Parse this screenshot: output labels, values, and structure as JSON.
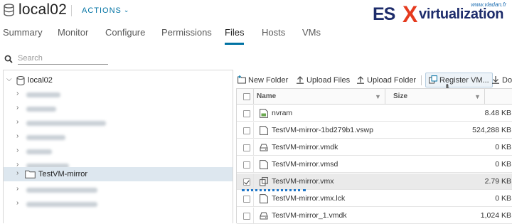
{
  "header": {
    "title": "local02",
    "actions_label": "ACTIONS",
    "actions_caret": "⌄"
  },
  "logo": {
    "url": "www.vladan.fr",
    "es": "ES",
    "x": "X",
    "virtualization": "virtualization"
  },
  "tabs": [
    {
      "label": "Summary",
      "active": false
    },
    {
      "label": "Monitor",
      "active": false
    },
    {
      "label": "Configure",
      "active": false
    },
    {
      "label": "Permissions",
      "active": false
    },
    {
      "label": "Files",
      "active": true
    },
    {
      "label": "Hosts",
      "active": false
    },
    {
      "label": "VMs",
      "active": false
    }
  ],
  "search": {
    "placeholder": "Search",
    "value": ""
  },
  "tree": {
    "root": {
      "label": "local02",
      "expanded": true
    },
    "selected_folder": "TestVM-mirror"
  },
  "toolbar": {
    "new_folder": "New Folder",
    "upload_files": "Upload Files",
    "upload_folder": "Upload Folder",
    "register_vm": "Register VM...",
    "download": "Do"
  },
  "grid": {
    "columns": {
      "name": "Name",
      "size": "Size"
    },
    "rows": [
      {
        "name": "nvram",
        "size": "8.48 KB",
        "icon": "nvram-icon",
        "checked": false
      },
      {
        "name": "TestVM-mirror-1bd279b1.vswp",
        "size": "524,288 KB",
        "icon": "file-icon",
        "checked": false
      },
      {
        "name": "TestVM-mirror.vmdk",
        "size": "0 KB",
        "icon": "disk-icon",
        "checked": false
      },
      {
        "name": "TestVM-mirror.vmsd",
        "size": "0 KB",
        "icon": "file-icon",
        "checked": false
      },
      {
        "name": "TestVM-mirror.vmx",
        "size": "2.79 KB",
        "icon": "vmx-icon",
        "checked": true
      },
      {
        "name": "TestVM-mirror.vmx.lck",
        "size": "0 KB",
        "icon": "file-icon",
        "checked": false
      },
      {
        "name": "TestVM-mirror_1.vmdk",
        "size": "1,024 KB",
        "icon": "disk-icon",
        "checked": false
      }
    ]
  },
  "colors": {
    "accent": "#0072a3",
    "selection_tree": "#dde7ef",
    "selection_grid": "#eaeaea",
    "dotted_underline": "#1f77c9"
  }
}
